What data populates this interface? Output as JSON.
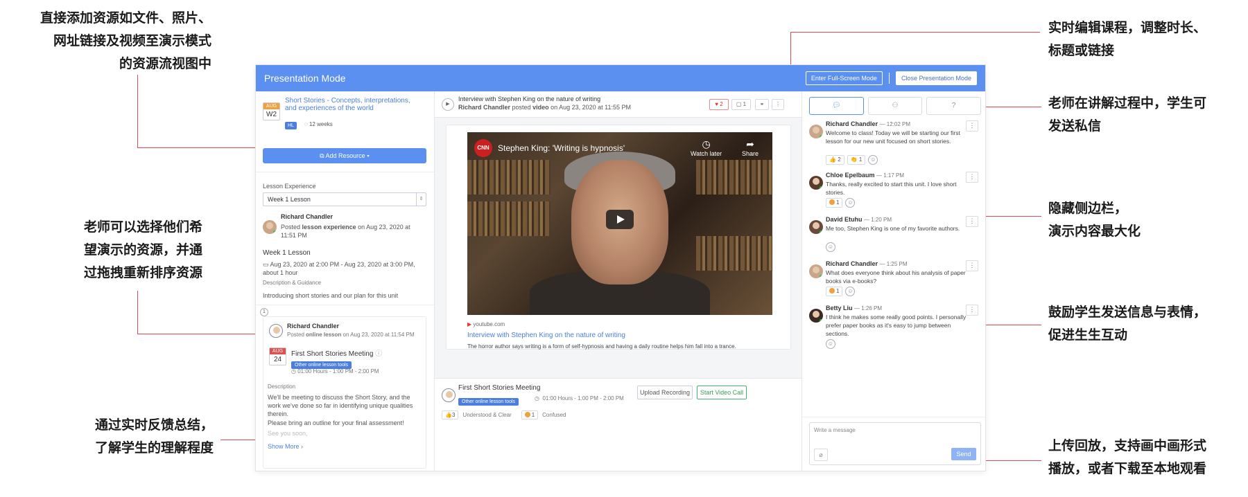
{
  "annotations": {
    "left_top": "直接添加资源如文件、照片、\n网址链接及视频至演示模式\n的资源流视图中",
    "left_mid": "老师可以选择他们希\n望演示的资源，并通\n过拖拽重新排序资源",
    "left_bottom": "通过实时反馈总结，\n了解学生的理解程度",
    "right_1": "实时编辑课程，调整时长、\n标题或链接",
    "right_2": "老师在讲解过程中，学生可\n发送私信",
    "right_3": "隐藏侧边栏，\n演示内容最大化",
    "right_4": "鼓励学生发送信息与表情，\n促进生生互动",
    "right_5": "上传回放，支持画中画形式\n播放，或者下载至本地观看"
  },
  "window": {
    "title": "Presentation Mode",
    "fullscreen_btn": "Enter Full-Screen Mode",
    "close_btn": "Close Presentation Mode"
  },
  "left": {
    "course": {
      "month": "AUG",
      "week": "W2",
      "title": "Short Stories - Concepts, interpretations, and experiences of the world",
      "tag": "HL",
      "duration": "12 weeks"
    },
    "add_resource": "Add Resource",
    "lesson_experience_label": "Lesson Experience",
    "lesson_select": "Week 1 Lesson",
    "poster": {
      "name": "Richard Chandler",
      "posted_prefix": "Posted",
      "item": "lesson experience",
      "date": "on Aug 23, 2020 at 11:51 PM"
    },
    "lesson_title": "Week 1 Lesson",
    "lesson_time": "Aug 23, 2020 at 2:00 PM - Aug 23, 2020 at 3:00 PM, about 1 hour",
    "desc_label": "Description & Guidance",
    "desc_text": "Introducing short stories and our plan for this unit",
    "card": {
      "index": "1",
      "name": "Richard Chandler",
      "posted_prefix": "Posted",
      "item": "online lesson",
      "date": "on Aug 23, 2020 at 11:54 PM",
      "month": "AUG",
      "day": "24",
      "meeting": "First Short Stories Meeting",
      "tool": "Other online lesson tools",
      "time": "01:00 Hours - 1:00 PM - 2:00 PM",
      "desc_label": "Description",
      "desc_1": "We'll be meeting to discuss the Short Story, and the work we've done so far in identifying unique qualities therein.",
      "desc_2": "Please bring an outline for your final assessment!",
      "desc_3": "See you soon,",
      "show_more": "Show More"
    }
  },
  "mid": {
    "header": {
      "title": "Interview with Stephen King on the nature of writing",
      "author": "Richard Chandler",
      "posted": "posted",
      "type": "video",
      "date": "on Aug 23, 2020 at 11:55 PM",
      "likes": "2",
      "comments": "1"
    },
    "video": {
      "logo": "CNN",
      "title": "Stephen King: 'Writing is hypnosis'",
      "watch_later": "Watch later",
      "share": "Share"
    },
    "source": "youtube.com",
    "link_title": "Interview with Stephen King on the nature of writing",
    "link_desc": "The horror author says writing is a form of self-hypnosis and having a daily routine helps him fall into a trance.",
    "footer": {
      "meeting": "First Short Stories Meeting",
      "tool": "Other online lesson tools",
      "time": "01:00 Hours - 1:00 PM - 2:00 PM",
      "upload": "Upload Recording",
      "start": "Start Video Call",
      "understood_count": "3",
      "understood": "Understood & Clear",
      "confused_count": "1",
      "confused": "Confused"
    }
  },
  "right": {
    "messages": [
      {
        "name": "Richard Chandler",
        "time": "— 12:02 PM",
        "text": "Welcome to class! Today we will be starting our first lesson for our new unit focused on short stories.",
        "r1": "2",
        "r2": "1"
      },
      {
        "name": "Chloe Epelbaum",
        "time": "— 1:17 PM",
        "text": "Thanks, really excited to start this unit. I love short stories.",
        "r1": "1"
      },
      {
        "name": "David Etuhu",
        "time": "— 1:20 PM",
        "text": "Me too, Stephen King is one of my favorite authors."
      },
      {
        "name": "Richard Chandler",
        "time": "— 1:25 PM",
        "text": "What does everyone think about his analysis of paper books via e-books?",
        "r1": "1"
      },
      {
        "name": "Betty Liu",
        "time": "— 1:26 PM",
        "text": "I think he makes some really good points. I personally prefer paper books as it's easy to jump between sections."
      }
    ],
    "placeholder": "Write a message",
    "send": "Send"
  }
}
